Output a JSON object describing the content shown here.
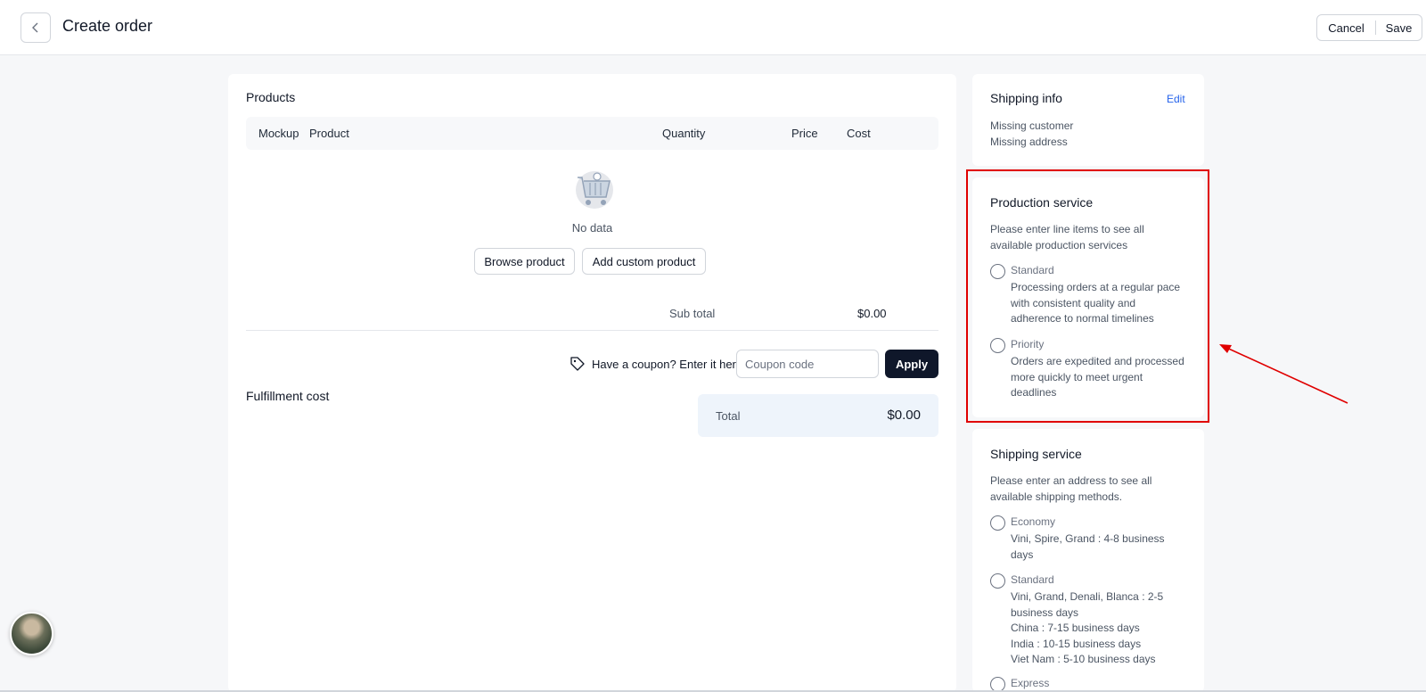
{
  "header": {
    "title": "Create order",
    "cancel_label": "Cancel",
    "save_label": "Save"
  },
  "products": {
    "title": "Products",
    "columns": [
      "Mockup",
      "Product",
      "Quantity",
      "Price",
      "Cost"
    ],
    "empty_text": "No data",
    "browse_label": "Browse product",
    "add_custom_label": "Add custom product",
    "subtotal_label": "Sub total",
    "subtotal_value": "$0.00",
    "coupon_label": "Have a coupon? Enter it here",
    "coupon_placeholder": "Coupon code",
    "apply_label": "Apply",
    "fulfillment_title": "Fulfillment cost",
    "total_label": "Total",
    "total_value": "$0.00"
  },
  "shipping_info": {
    "title": "Shipping info",
    "edit_label": "Edit",
    "lines": [
      "Missing customer",
      "Missing address"
    ]
  },
  "production_service": {
    "title": "Production service",
    "hint": "Please enter line items to see all available production services",
    "options": [
      {
        "name": "Standard",
        "desc": "Processing orders at a regular pace with consistent quality and adherence to normal timelines"
      },
      {
        "name": "Priority",
        "desc": "Orders are expedited and processed more quickly to meet urgent deadlines"
      }
    ]
  },
  "shipping_service": {
    "title": "Shipping service",
    "hint": "Please enter an address to see all available shipping methods.",
    "options": [
      {
        "name": "Economy",
        "desc": "Vini, Spire, Grand : 4-8 business days"
      },
      {
        "name": "Standard",
        "desc": "Vini, Grand, Denali, Blanca : 2-5 business days\nChina : 7-15 business days\nIndia : 10-15 business days\nViet Nam : 5-10 business days"
      },
      {
        "name": "Express",
        "desc": ""
      }
    ]
  },
  "annotation": {
    "highlight_color": "#e00000"
  },
  "colors": {
    "primary_button": "#0f172a",
    "link": "#2563eb",
    "total_bg": "#eef4fb"
  }
}
